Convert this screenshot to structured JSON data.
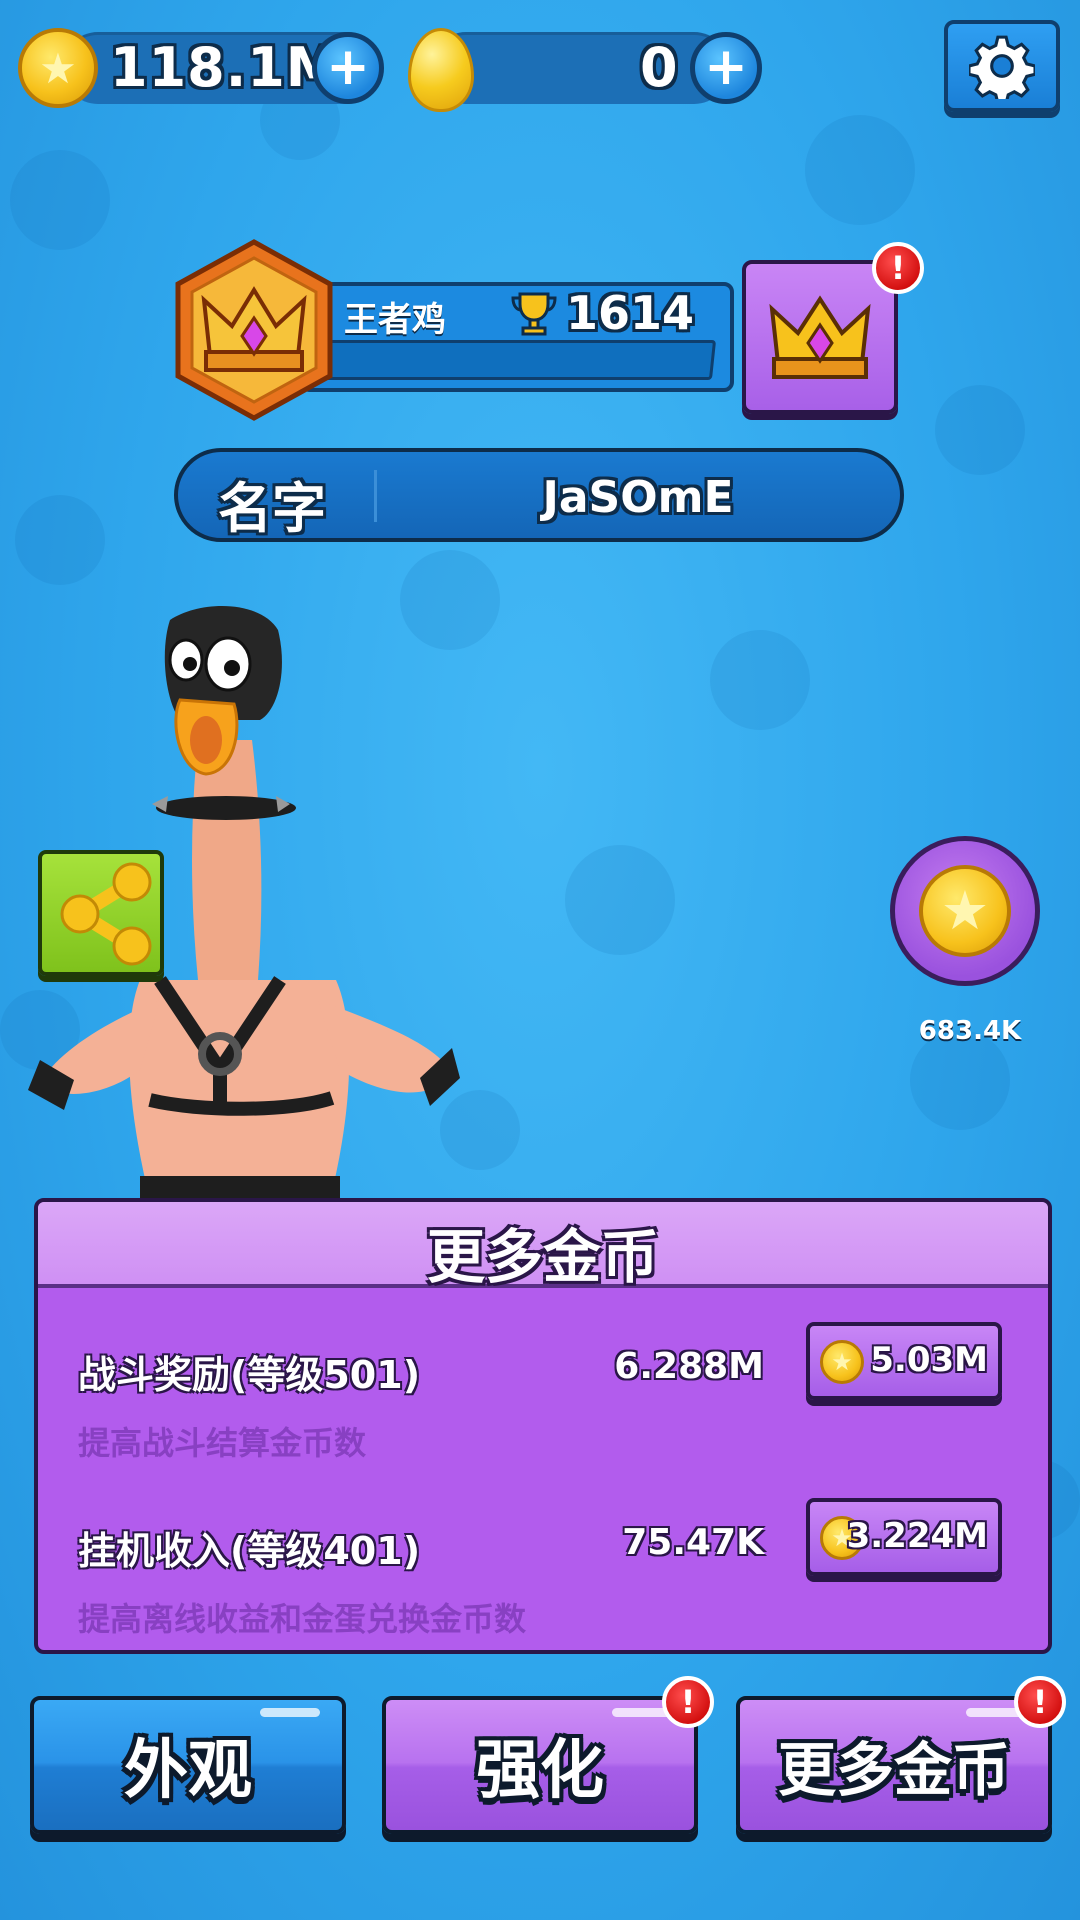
{
  "topbar": {
    "coins": "118.1M",
    "eggs": "0",
    "plus_symbol": "+",
    "icons": [
      "coin-icon",
      "egg-icon",
      "gear-icon"
    ]
  },
  "profile": {
    "rank_title": "王者鸡",
    "trophies": "1614",
    "name_label": "名字",
    "player_name": "JaSOmE",
    "rank_alert": "!",
    "rank_progress_fraction": 0.0
  },
  "side": {
    "bonus_value": "683.4K",
    "icons": [
      "share-icon",
      "coin-bonus-icon"
    ]
  },
  "panel": {
    "title": "更多金币",
    "rows": [
      {
        "title": "战斗奖励(等级501)",
        "value": "6.288M",
        "description": "提高战斗结算金币数",
        "cost": "5.03M"
      },
      {
        "title": "挂机收入(等级401)",
        "value": "75.47K",
        "description": "提高离线收益和金蛋兑换金币数",
        "cost": "3.224M"
      }
    ]
  },
  "bottom_nav": {
    "appearance": "外观",
    "upgrade": "强化",
    "more_coins": "更多金币",
    "alert": "!"
  },
  "colors": {
    "background": "#2fa6ec",
    "panel": "#b25ced",
    "panel_header": "#cf90f4",
    "blue_button": "#2a93e8",
    "purple_button": "#b872ef",
    "alert": "#d10d0d",
    "share_button": "#7fc21c"
  }
}
